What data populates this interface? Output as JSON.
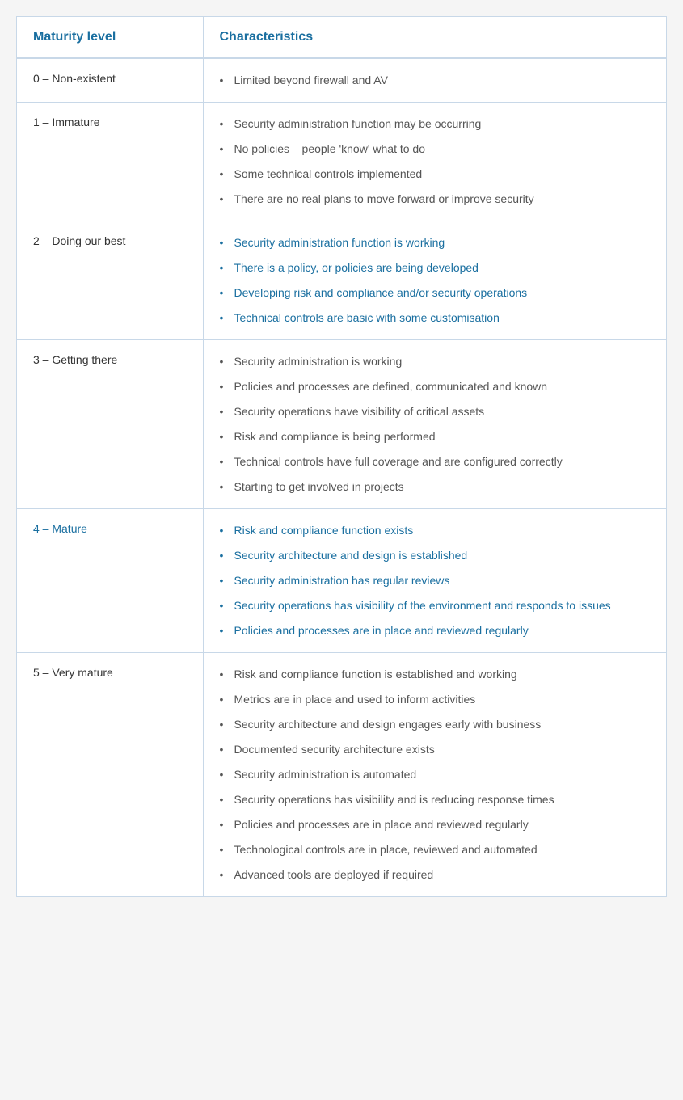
{
  "table": {
    "header": {
      "col1": "Maturity level",
      "col2": "Characteristics"
    },
    "rows": [
      {
        "level": "0 – Non-existent",
        "levelBlue": false,
        "bulletStyle": "gray",
        "items": [
          "Limited beyond firewall and AV"
        ]
      },
      {
        "level": "1 – Immature",
        "levelBlue": false,
        "bulletStyle": "gray",
        "items": [
          "Security administration function may be occurring",
          "No policies – people 'know' what to do",
          "Some technical controls implemented",
          "There are no real plans to move forward or improve security"
        ]
      },
      {
        "level": "2 – Doing our best",
        "levelBlue": false,
        "bulletStyle": "blue",
        "items": [
          "Security administration function is working",
          "There is a policy, or policies are being developed",
          "Developing risk and compliance and/or security operations",
          "Technical controls are basic with some customisation"
        ]
      },
      {
        "level": "3 – Getting there",
        "levelBlue": false,
        "bulletStyle": "gray",
        "items": [
          "Security administration is working",
          "Policies and processes are defined, communicated and known",
          "Security operations have visibility of critical assets",
          "Risk and compliance is being performed",
          "Technical controls have full coverage and are configured correctly",
          "Starting to get involved in projects"
        ]
      },
      {
        "level": "4 – Mature",
        "levelBlue": true,
        "bulletStyle": "blue",
        "items": [
          "Risk and compliance function exists",
          "Security architecture and design is established",
          "Security administration has regular reviews",
          "Security operations has visibility of the environment and responds to issues",
          "Policies and processes are in place and reviewed regularly"
        ]
      },
      {
        "level": "5 – Very mature",
        "levelBlue": false,
        "bulletStyle": "gray",
        "items": [
          "Risk and compliance function is established and working",
          "Metrics are in place and used to inform activities",
          "Security architecture and design engages early with business",
          "Documented security architecture exists",
          "Security administration is automated",
          "Security operations has visibility and is reducing response times",
          "Policies and processes are in place and reviewed regularly",
          "Technological controls are in place, reviewed and automated",
          "Advanced tools are deployed if required"
        ]
      }
    ]
  }
}
